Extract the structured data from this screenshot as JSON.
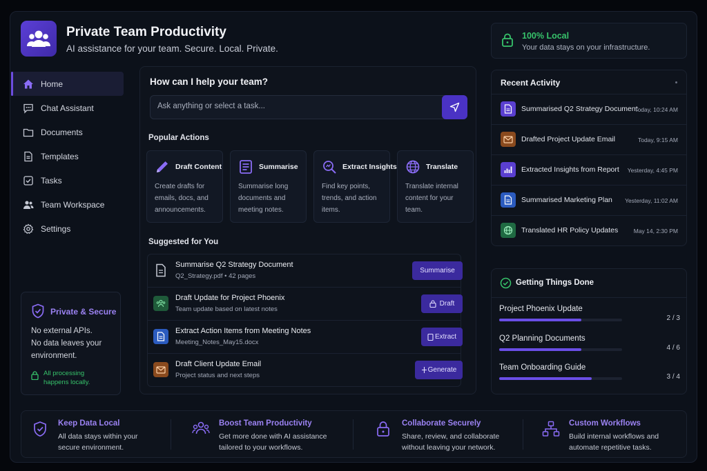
{
  "header": {
    "title": "Private Team Productivity",
    "subtitle": "AI assistance for your team. Secure. Local. Private."
  },
  "local_status": {
    "title": "100% Local",
    "subtitle": "Your data stays on your infrastructure."
  },
  "sidebar": {
    "items": [
      {
        "label": "Home",
        "icon": "home-icon",
        "active": true
      },
      {
        "label": "Chat Assistant",
        "icon": "chat-icon"
      },
      {
        "label": "Documents",
        "icon": "folder-icon"
      },
      {
        "label": "Templates",
        "icon": "file-icon"
      },
      {
        "label": "Tasks",
        "icon": "checkbox-icon"
      },
      {
        "label": "Team Workspace",
        "icon": "users-icon"
      },
      {
        "label": "Settings",
        "icon": "gear-icon"
      }
    ],
    "secure_card": {
      "title": "Private & Secure",
      "lines": [
        "No external APIs.",
        "No data leaves your",
        "environment."
      ],
      "note_1": "All processing",
      "note_2": "happens locally."
    }
  },
  "main": {
    "heading": "How can I help your team?",
    "search_placeholder": "Ask anything or select a task...",
    "popular_label": "Popular Actions",
    "actions": [
      {
        "title": "Draft Content",
        "desc": "Create drafts for emails, docs, and announcements.",
        "icon": "pencil-icon"
      },
      {
        "title": "Summarise",
        "desc": "Summarise long documents and meeting notes.",
        "icon": "document-lines-icon"
      },
      {
        "title": "Extract Insights",
        "desc": "Find key points, trends, and action items.",
        "icon": "magnify-insights-icon"
      },
      {
        "title": "Translate",
        "desc": "Translate internal content for your team.",
        "icon": "globe-icon"
      }
    ],
    "suggested_label": "Suggested for You",
    "suggestions": [
      {
        "title": "Summarise Q2 Strategy Document",
        "sub": "Q2_Strategy.pdf • 42 pages",
        "button": "Summarise",
        "icon": "document-icon",
        "color": "#1b2130"
      },
      {
        "title": "Draft Update for Project Phoenix",
        "sub": "Team update based on latest notes",
        "button": "Draft",
        "icon": "team-icon",
        "color": "#1f5a3a"
      },
      {
        "title": "Extract Action Items from Meeting Notes",
        "sub": "Meeting_Notes_May15.docx",
        "button": "Extract",
        "icon": "doc-blue-icon",
        "color": "#2b5bbf"
      },
      {
        "title": "Draft Client Update Email",
        "sub": "Project status and next steps",
        "button": "Generate",
        "icon": "mail-icon",
        "color": "#8a4a1e"
      }
    ]
  },
  "recent": {
    "title": "Recent Activity",
    "items": [
      {
        "title": "Summarised Q2 Strategy Document",
        "time": "Today, 10:24 AM",
        "icon": "doc-purple-icon",
        "color": "#5a3fd0"
      },
      {
        "title": "Drafted Project Update Email",
        "time": "Today, 9:15 AM",
        "icon": "mail-icon",
        "color": "#8a4a1e"
      },
      {
        "title": "Extracted Insights from Report",
        "time": "Yesterday, 4:45 PM",
        "icon": "bar-chart-icon",
        "color": "#5a3fd0"
      },
      {
        "title": "Summarised Marketing Plan",
        "time": "Yesterday, 11:02 AM",
        "icon": "doc-blue-icon",
        "color": "#2b5bbf"
      },
      {
        "title": "Translated HR Policy Updates",
        "time": "May 14, 2:30 PM",
        "icon": "globe-icon",
        "color": "#1f6a42"
      }
    ]
  },
  "gtd": {
    "title": "Getting Things Done",
    "items": [
      {
        "label": "Project Phoenix Update",
        "count": "2 / 3",
        "progress": 0.667
      },
      {
        "label": "Q2 Planning Documents",
        "count": "4 / 6",
        "progress": 0.667
      },
      {
        "label": "Team Onboarding Guide",
        "count": "3 / 4",
        "progress": 0.75
      }
    ]
  },
  "features": [
    {
      "title": "Keep Data Local",
      "desc": "All data stays within your secure environment.",
      "icon": "shield-check-icon"
    },
    {
      "title": "Boost Team Productivity",
      "desc": "Get more done with AI assistance tailored to your workflows.",
      "icon": "team-icon"
    },
    {
      "title": "Collaborate Securely",
      "desc": "Share, review, and collaborate without leaving your network.",
      "icon": "lock-icon"
    },
    {
      "title": "Custom Workflows",
      "desc": "Build internal workflows and automate repetitive tasks.",
      "icon": "workflow-icon"
    }
  ]
}
